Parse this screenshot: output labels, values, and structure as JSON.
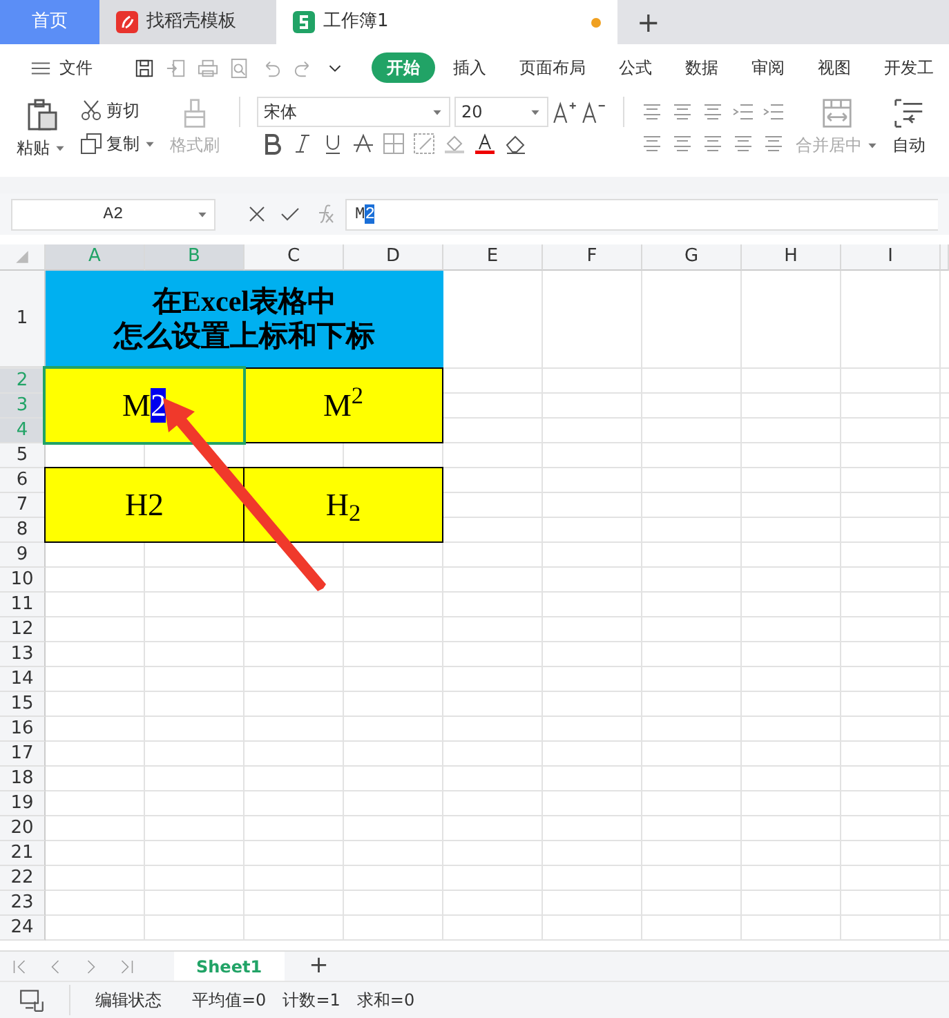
{
  "tabs": [
    {
      "kind": "home",
      "label": "首页",
      "selected": false
    },
    {
      "kind": "docer",
      "label": "找稻壳模板",
      "selected": false
    },
    {
      "kind": "sheet",
      "label": "工作簿1",
      "selected": true,
      "unsaved": true
    }
  ],
  "new_tab_button": "+",
  "menu": {
    "file": "文件",
    "tabs": [
      {
        "label": "开始",
        "selected": true
      },
      {
        "label": "插入",
        "selected": false
      },
      {
        "label": "页面布局",
        "selected": false
      },
      {
        "label": "公式",
        "selected": false
      },
      {
        "label": "数据",
        "selected": false
      },
      {
        "label": "审阅",
        "selected": false
      },
      {
        "label": "视图",
        "selected": false
      },
      {
        "label": "开发工",
        "selected": false
      }
    ]
  },
  "ribbon": {
    "paste": "粘贴",
    "cut": "剪切",
    "copy": "复制",
    "format_painter": {
      "label": "格式刷",
      "disabled": true
    },
    "font_name": "宋体",
    "font_size": "20",
    "merge_center": {
      "label": "合并居中",
      "disabled": true
    },
    "wrap_text": "自动"
  },
  "formula_bar": {
    "name_box": "A2",
    "value": "M2",
    "highlight_last": true
  },
  "columns": [
    {
      "label": "A",
      "selected": true
    },
    {
      "label": "B",
      "selected": true
    },
    {
      "label": "C",
      "selected": false
    },
    {
      "label": "D",
      "selected": false
    },
    {
      "label": "E",
      "selected": false
    },
    {
      "label": "F",
      "selected": false
    },
    {
      "label": "G",
      "selected": false
    },
    {
      "label": "H",
      "selected": false
    },
    {
      "label": "I",
      "selected": false
    }
  ],
  "rows": [
    {
      "label": "1",
      "selected": false
    },
    {
      "label": "2",
      "selected": true
    },
    {
      "label": "3",
      "selected": true
    },
    {
      "label": "4",
      "selected": true
    },
    {
      "label": "5",
      "selected": false
    },
    {
      "label": "6",
      "selected": false
    },
    {
      "label": "7",
      "selected": false
    },
    {
      "label": "8",
      "selected": false
    },
    {
      "label": "9",
      "selected": false
    },
    {
      "label": "10",
      "selected": false
    },
    {
      "label": "11",
      "selected": false
    },
    {
      "label": "12",
      "selected": false
    },
    {
      "label": "13",
      "selected": false
    },
    {
      "label": "14",
      "selected": false
    },
    {
      "label": "15",
      "selected": false
    },
    {
      "label": "16",
      "selected": false
    },
    {
      "label": "17",
      "selected": false
    },
    {
      "label": "18",
      "selected": false
    },
    {
      "label": "19",
      "selected": false
    },
    {
      "label": "20",
      "selected": false
    },
    {
      "label": "21",
      "selected": false
    },
    {
      "label": "22",
      "selected": false
    },
    {
      "label": "23",
      "selected": false
    },
    {
      "label": "24",
      "selected": false
    }
  ],
  "cells": [
    {
      "color": "#00b0f0",
      "kind": "title",
      "lines": [
        "在Excel表格中",
        "怎么设置上标和下标"
      ]
    },
    {
      "color": "#ffff00",
      "kind": "editing",
      "active": true,
      "text": "M2",
      "highlight_last": true
    },
    {
      "color": "#ffff00",
      "kind": "text",
      "active": false,
      "text": "M$^{2}$"
    },
    {
      "color": "#ffff00",
      "kind": "text",
      "active": false,
      "text": "H2"
    },
    {
      "color": "#ffff00",
      "kind": "text",
      "active": false,
      "text": "H$_{2}$"
    }
  ],
  "sheet_tabs": [
    {
      "label": "Sheet1",
      "selected": true
    }
  ],
  "add_sheet_button": "+",
  "status_bar": {
    "mode": "编辑状态",
    "average": "平均值=0",
    "count": "计数=1",
    "sum": "求和=0"
  }
}
